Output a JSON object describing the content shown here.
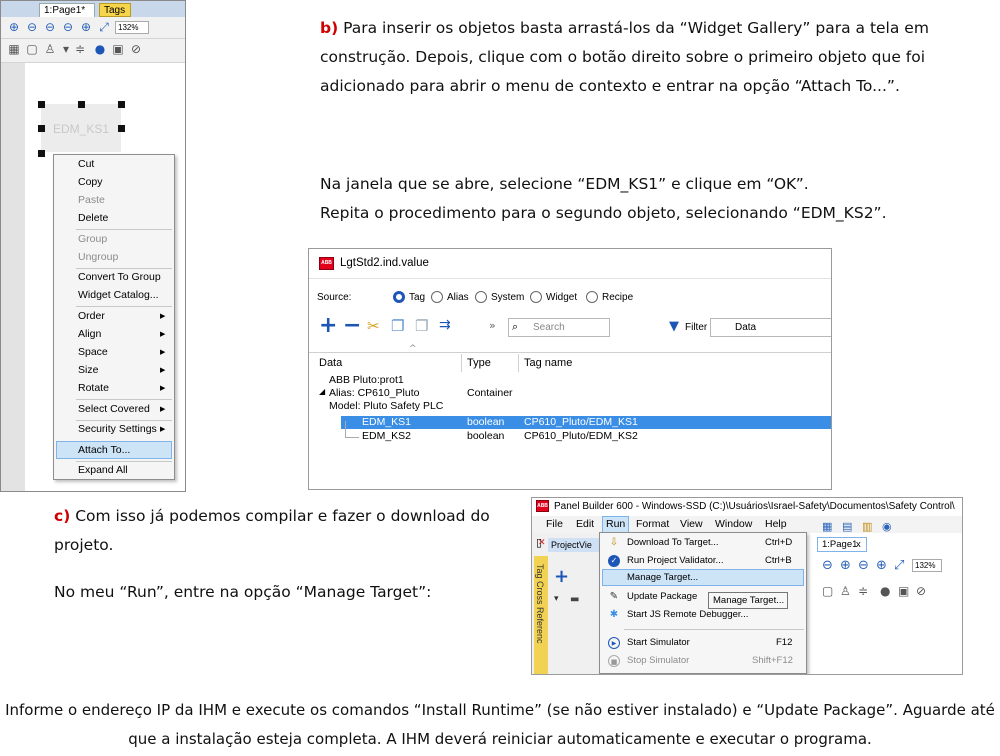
{
  "paragraph_b": {
    "marker": "b)",
    "text": " Para inserir os objetos basta arrastá-los da “Widget Gallery” para a tela em construção. Depois, clique com o botão direito sobre o primeiro objeto que foi adicionado para abrir o menu de contexto e entrar na opção “Attach To...”."
  },
  "paragraph_b2": {
    "line1": "Na janela que se abre, selecione “EDM_KS1” e clique em “OK”.",
    "line2": "Repita o procedimento para o segundo objeto, selecionando “EDM_KS2”."
  },
  "paragraph_c": {
    "marker": "c)",
    "text": " Com isso já podemos compilar e fazer o download do projeto.",
    "line2": "No meu “Run”, entre na opção “Manage Target”:"
  },
  "final_paragraph": "Informe o endereço IP da IHM e execute os comandos “Install Runtime” (se não estiver instalado) e “Update Package”. Aguarde até que a instalação esteja completa. A IHM deverá reiniciar automaticamente e executar o programa.",
  "designer": {
    "tabs": {
      "page": "1:Page1*",
      "close": "x",
      "tags": "Tags"
    },
    "zoom": "132%",
    "widget_label": "EDM_KS1",
    "context_menu": [
      {
        "label": "Cut",
        "disabled": false
      },
      {
        "label": "Copy",
        "disabled": false
      },
      {
        "label": "Paste",
        "disabled": true
      },
      {
        "label": "Delete",
        "disabled": false
      },
      {
        "label": "Group",
        "disabled": true
      },
      {
        "label": "Ungroup",
        "disabled": true
      },
      {
        "label": "Convert To Group",
        "disabled": false
      },
      {
        "label": "Widget Catalog...",
        "disabled": false
      },
      {
        "label": "Order",
        "disabled": false,
        "submenu": true
      },
      {
        "label": "Align",
        "disabled": false,
        "submenu": true
      },
      {
        "label": "Space",
        "disabled": false,
        "submenu": true
      },
      {
        "label": "Size",
        "disabled": false,
        "submenu": true
      },
      {
        "label": "Rotate",
        "disabled": false,
        "submenu": true
      },
      {
        "label": "Select Covered",
        "disabled": false,
        "submenu": true
      },
      {
        "label": "Security Settings",
        "disabled": false,
        "submenu": true
      },
      {
        "label": "Attach To...",
        "disabled": false,
        "highlighted": true
      },
      {
        "label": "Expand All",
        "disabled": false
      }
    ]
  },
  "tag_dialog": {
    "logo": "ABB",
    "title": "LgtStd2.ind.value",
    "source_label": "Source:",
    "sources": [
      {
        "label": "Tag",
        "selected": true
      },
      {
        "label": "Alias",
        "selected": false
      },
      {
        "label": "System",
        "selected": false
      },
      {
        "label": "Widget",
        "selected": false
      },
      {
        "label": "Recipe",
        "selected": false
      }
    ],
    "search_placeholder": "Search",
    "filter_label": "Filter by:",
    "filter_value": "Data",
    "columns": [
      "Data",
      "Type",
      "Tag name"
    ],
    "rows": [
      {
        "data": "ABB Pluto:prot1",
        "type": "",
        "tag": ""
      },
      {
        "data": "Alias: CP610_Pluto",
        "type": "Container",
        "tag": ""
      },
      {
        "data": "Model: Pluto Safety PLC",
        "type": "",
        "tag": ""
      },
      {
        "data": "EDM_KS1",
        "type": "boolean",
        "tag": "CP610_Pluto/EDM_KS1",
        "selected": true
      },
      {
        "data": "EDM_KS2",
        "type": "boolean",
        "tag": "CP610_Pluto/EDM_KS2"
      }
    ]
  },
  "panel_builder": {
    "logo": "ABB",
    "title": "Panel Builder 600 - Windows-SSD (C:)\\Usuários\\Israel-Safety\\Documentos\\Safety Control\\",
    "menus": [
      "File",
      "Edit",
      "Run",
      "Format",
      "View",
      "Window",
      "Help"
    ],
    "project_tab": "ProjectVie",
    "side_tab": "Tag Cross Referenc",
    "page_tab": "1:Page1",
    "page_tab_close": "x",
    "zoom": "132%",
    "run_menu": [
      {
        "icon": "download-icon",
        "label": "Download To Target...",
        "shortcut": "Ctrl+D"
      },
      {
        "icon": "check-icon",
        "label": "Run Project Validator...",
        "shortcut": "Ctrl+B"
      },
      {
        "icon": "",
        "label": "Manage Target...",
        "shortcut": "",
        "highlighted": true
      },
      {
        "icon": "pencil-icon",
        "label": "Update Package",
        "shortcut": ""
      },
      {
        "icon": "bug-icon",
        "label": "Start JS Remote Debugger...",
        "shortcut": ""
      },
      {
        "icon": "play-icon",
        "label": "Start Simulator",
        "shortcut": "F12"
      },
      {
        "icon": "stop-icon",
        "label": "Stop Simulator",
        "shortcut": "Shift+F12",
        "disabled": true
      }
    ],
    "tooltip": "Manage Target..."
  },
  "colors": {
    "accent_red": "#d10000",
    "selection_blue": "#3a8ee6",
    "menu_highlight": "#cde4f7",
    "abb_red": "#e2001a",
    "tags_tab_yellow": "#f7d54a"
  }
}
